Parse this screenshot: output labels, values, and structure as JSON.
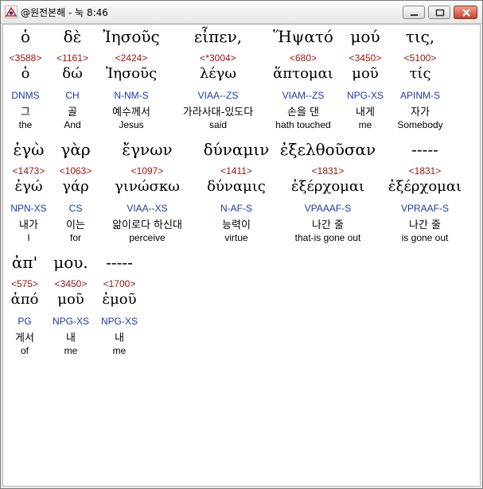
{
  "window": {
    "title": "@원전본해 - 눅 8:46",
    "icon": "app-logo-icon",
    "controls": [
      "minimize-icon",
      "maximize-icon",
      "close-icon"
    ]
  },
  "verse": {
    "rows": [
      {
        "words": [
          {
            "greek": "ὁ",
            "num": "<3588>",
            "lemma": "ὁ",
            "morph": "DNMS",
            "kor": "그",
            "eng": "the"
          },
          {
            "greek": "δὲ",
            "num": "<1161>",
            "lemma": "δώ",
            "morph": "CH",
            "kor": "골",
            "eng": "And"
          },
          {
            "greek": "Ἰησοῦς",
            "num": "<2424>",
            "lemma": "Ἰησοῦς",
            "morph": "N-NM-S",
            "kor": "예수께서",
            "eng": "Jesus"
          },
          {
            "greek": "εἶπεν,",
            "num": "<*3004>",
            "lemma": "λέγω",
            "morph": "VIAA--ZS",
            "kor": "가라사대-있도다",
            "eng": "said"
          },
          {
            "greek": "Ἥψατό",
            "num": "<680>",
            "lemma": "ἅπτομαι",
            "morph": "VIAM--ZS",
            "kor": "손을 댄",
            "eng": "hath touched"
          },
          {
            "greek": "μού",
            "num": "<3450>",
            "lemma": "μοῦ",
            "morph": "NPG-XS",
            "kor": "내게",
            "eng": "me"
          },
          {
            "greek": "τις,",
            "num": "<5100>",
            "lemma": "τίς",
            "morph": "APINM-S",
            "kor": "자가",
            "eng": "Somebody"
          }
        ]
      },
      {
        "words": [
          {
            "greek": "ἐγὼ",
            "num": "<1473>",
            "lemma": "ἐγώ",
            "morph": "NPN-XS",
            "kor": "내가",
            "eng": "I"
          },
          {
            "greek": "γὰρ",
            "num": "<1063>",
            "lemma": "γάρ",
            "morph": "CS",
            "kor": "이는",
            "eng": "for"
          },
          {
            "greek": "ἔγνων",
            "num": "<1097>",
            "lemma": "γινώσκω",
            "morph": "VIAA--XS",
            "kor": "앎이로다 하신대",
            "eng": "perceive"
          },
          {
            "greek": "δύναμιν",
            "num": "<1411>",
            "lemma": "δύναμις",
            "morph": "N-AF-S",
            "kor": "능력이",
            "eng": "virtue"
          },
          {
            "greek": "ἐξελθοῦσαν",
            "num": "<1831>",
            "lemma": "ἐξέρχομαι",
            "morph": "VPAAAF-S",
            "kor": "나간 줄",
            "eng": "that-is gone out"
          },
          {
            "greek": "-----",
            "num": "<1831>",
            "lemma": "ἐξέρχομαι",
            "morph": "VPRAAF-S",
            "kor": "나간 줄",
            "eng": "is gone out"
          }
        ]
      },
      {
        "words": [
          {
            "greek": "ἀπ'",
            "num": "<575>",
            "lemma": "ἀπό",
            "morph": "PG",
            "kor": "게서",
            "eng": "of"
          },
          {
            "greek": "μου.",
            "num": "<3450>",
            "lemma": "μοῦ",
            "morph": "NPG-XS",
            "kor": "내",
            "eng": "me"
          },
          {
            "greek": "-----",
            "num": "<1700>",
            "lemma": "ἐμοῦ",
            "morph": "NPG-XS",
            "kor": "내",
            "eng": "me"
          }
        ]
      }
    ]
  },
  "colors": {
    "number": "#9c1010",
    "morph": "#1a3aa8",
    "text": "#000000",
    "background": "#ffffff",
    "chrome": "#ebebeb"
  }
}
